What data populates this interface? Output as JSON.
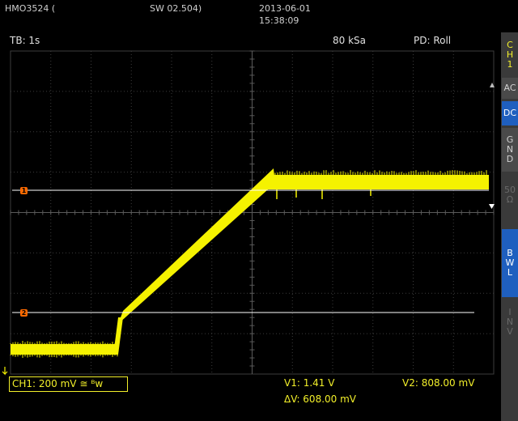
{
  "header": {
    "model": "HMO3524 (",
    "firmware": "SW 02.504)",
    "date": "2013-06-01",
    "time": "15:38:09"
  },
  "topbar": {
    "timebase": "TB: 1s",
    "samplerate": "80 kSa",
    "mode": "PD: Roll"
  },
  "side_menu": {
    "channel": [
      "C",
      "H",
      "1"
    ],
    "ac": "AC",
    "dc": "DC",
    "gnd": [
      "G",
      "N",
      "D"
    ],
    "fifty": [
      "50",
      "Ω"
    ],
    "bwl": [
      "B",
      "W",
      "L"
    ],
    "inv": [
      "I",
      "N",
      "V"
    ]
  },
  "markers": {
    "cursor1": "1",
    "cursor2": "2"
  },
  "status": {
    "channel": "CH1: 200 mV ≅ ᴮ𝗐",
    "v1": "V1: 1.41 V",
    "v2": "V2: 808.00 mV",
    "delta_v": "ΔV: 608.00 mV"
  },
  "colors": {
    "trace": "#f5f200",
    "cursor": "#ffffff",
    "grid": "#3c3c3c",
    "marker": "#ff6a00",
    "active_button": "#1f5fbf"
  }
}
